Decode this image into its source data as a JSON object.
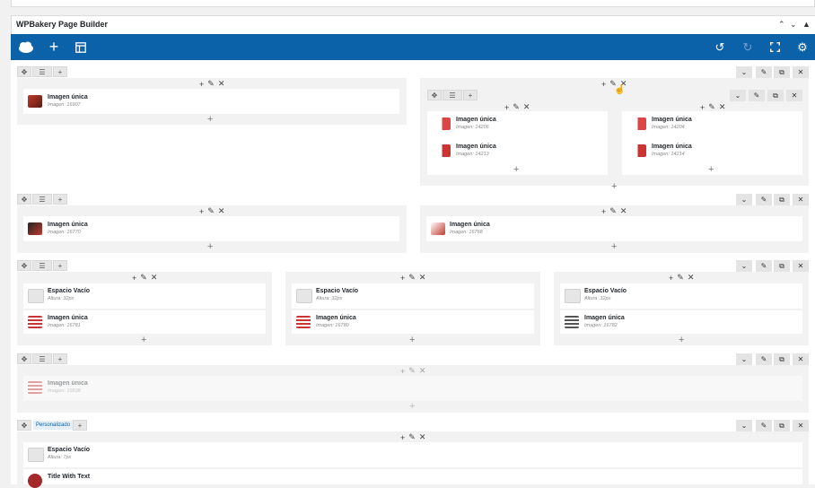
{
  "builder": {
    "title": "WPBakery Page Builder"
  },
  "rows": [
    {
      "columns": [
        {
          "elements": [
            {
              "title": "Imagen única",
              "sub": "Imagen: 16907"
            }
          ]
        },
        {
          "inner": [
            {
              "elements": [
                {
                  "title": "Imagen única",
                  "sub": "Imagen: 14206"
                },
                {
                  "title": "Imagen única",
                  "sub": "Imagen: 14213"
                }
              ]
            },
            {
              "elements": [
                {
                  "title": "Imagen única",
                  "sub": "Imagen: 14204"
                },
                {
                  "title": "Imagen única",
                  "sub": "Imagen: 14214"
                }
              ]
            }
          ]
        }
      ]
    },
    {
      "columns": [
        {
          "elements": [
            {
              "title": "Imagen única",
              "sub": "Imagen: 16770"
            }
          ]
        },
        {
          "elements": [
            {
              "title": "Imagen única",
              "sub": "Imagen: 16768"
            }
          ]
        }
      ]
    },
    {
      "columns": [
        {
          "elements": [
            {
              "title": "Espacio Vacío",
              "sub": "Altura: 32px"
            },
            {
              "title": "Imagen única",
              "sub": "Imagen: 16781"
            }
          ]
        },
        {
          "elements": [
            {
              "title": "Espacio Vacío",
              "sub": "Altura: 32px"
            },
            {
              "title": "Imagen única",
              "sub": "Imagen: 16780"
            }
          ]
        },
        {
          "elements": [
            {
              "title": "Espacio Vacío",
              "sub": "Altura: 32px"
            },
            {
              "title": "Imagen única",
              "sub": "Imagen: 16782"
            }
          ]
        }
      ]
    },
    {
      "columns": [
        {
          "elements": [
            {
              "title": "Imagen única",
              "sub": "Imagen: 16838"
            }
          ]
        }
      ]
    },
    {
      "badge": "Personalizado",
      "columns": [
        {
          "elements": [
            {
              "title": "Espacio Vacío",
              "sub": "Altura: 7px"
            },
            {
              "title": "Title With Text",
              "sub": ""
            }
          ]
        }
      ]
    }
  ],
  "colors": {
    "toolbar": "#0b62a8",
    "thumb_red": "#c0392b"
  },
  "icons": {
    "logo": "cloud-icon",
    "add": "plus-icon",
    "templates": "layout-icon",
    "undo": "undo-icon",
    "redo": "redo-icon",
    "fullscreen": "fullscreen-icon",
    "settings": "gear-icon"
  }
}
